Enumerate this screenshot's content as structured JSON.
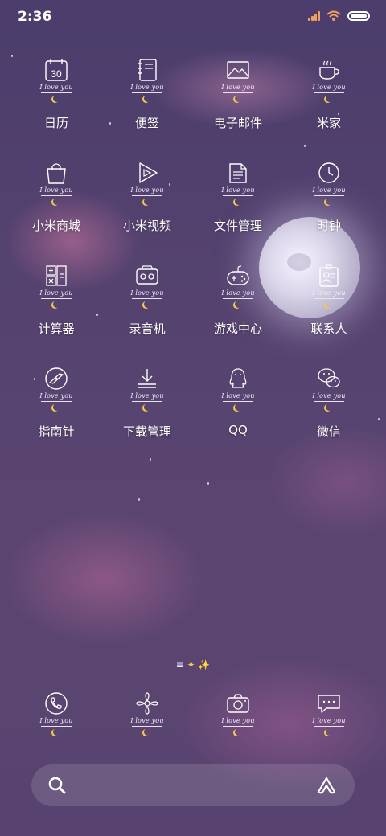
{
  "status_bar": {
    "time": "2:36"
  },
  "apps": [
    {
      "label": "日历",
      "tag": "I love you",
      "icon": "calendar-icon",
      "cal_num": "30"
    },
    {
      "label": "便签",
      "tag": "I love you",
      "icon": "notes-icon"
    },
    {
      "label": "电子邮件",
      "tag": "I love you",
      "icon": "email-icon"
    },
    {
      "label": "米家",
      "tag": "I love you",
      "icon": "cup-icon"
    },
    {
      "label": "小米商城",
      "tag": "I love you",
      "icon": "shopping-bag-icon"
    },
    {
      "label": "小米视频",
      "tag": "I love you",
      "icon": "video-play-icon"
    },
    {
      "label": "文件管理",
      "tag": "I love you",
      "icon": "file-icon"
    },
    {
      "label": "时钟",
      "tag": "I love you",
      "icon": "clock-icon"
    },
    {
      "label": "计算器",
      "tag": "I love you",
      "icon": "calculator-icon"
    },
    {
      "label": "录音机",
      "tag": "I love you",
      "icon": "recorder-icon"
    },
    {
      "label": "游戏中心",
      "tag": "I love you",
      "icon": "gamepad-icon"
    },
    {
      "label": "联系人",
      "tag": "I love you",
      "icon": "contacts-icon"
    },
    {
      "label": "指南针",
      "tag": "I love you",
      "icon": "compass-icon"
    },
    {
      "label": "下载管理",
      "tag": "I love you",
      "icon": "download-icon"
    },
    {
      "label": "QQ",
      "tag": "I love you",
      "icon": "qq-penguin-icon"
    },
    {
      "label": "微信",
      "tag": "I love you",
      "icon": "wechat-icon"
    }
  ],
  "dock": [
    {
      "tag": "I love you",
      "icon": "phone-icon"
    },
    {
      "tag": "I love you",
      "icon": "flower-icon"
    },
    {
      "tag": "I love you",
      "icon": "camera-icon"
    },
    {
      "tag": "I love you",
      "icon": "message-icon"
    }
  ],
  "page_indicator": {
    "lines": "≡",
    "dots": "✦ ✨"
  },
  "search_bar": {
    "left_icon": "search-icon",
    "right_icon": "assistant-icon"
  }
}
